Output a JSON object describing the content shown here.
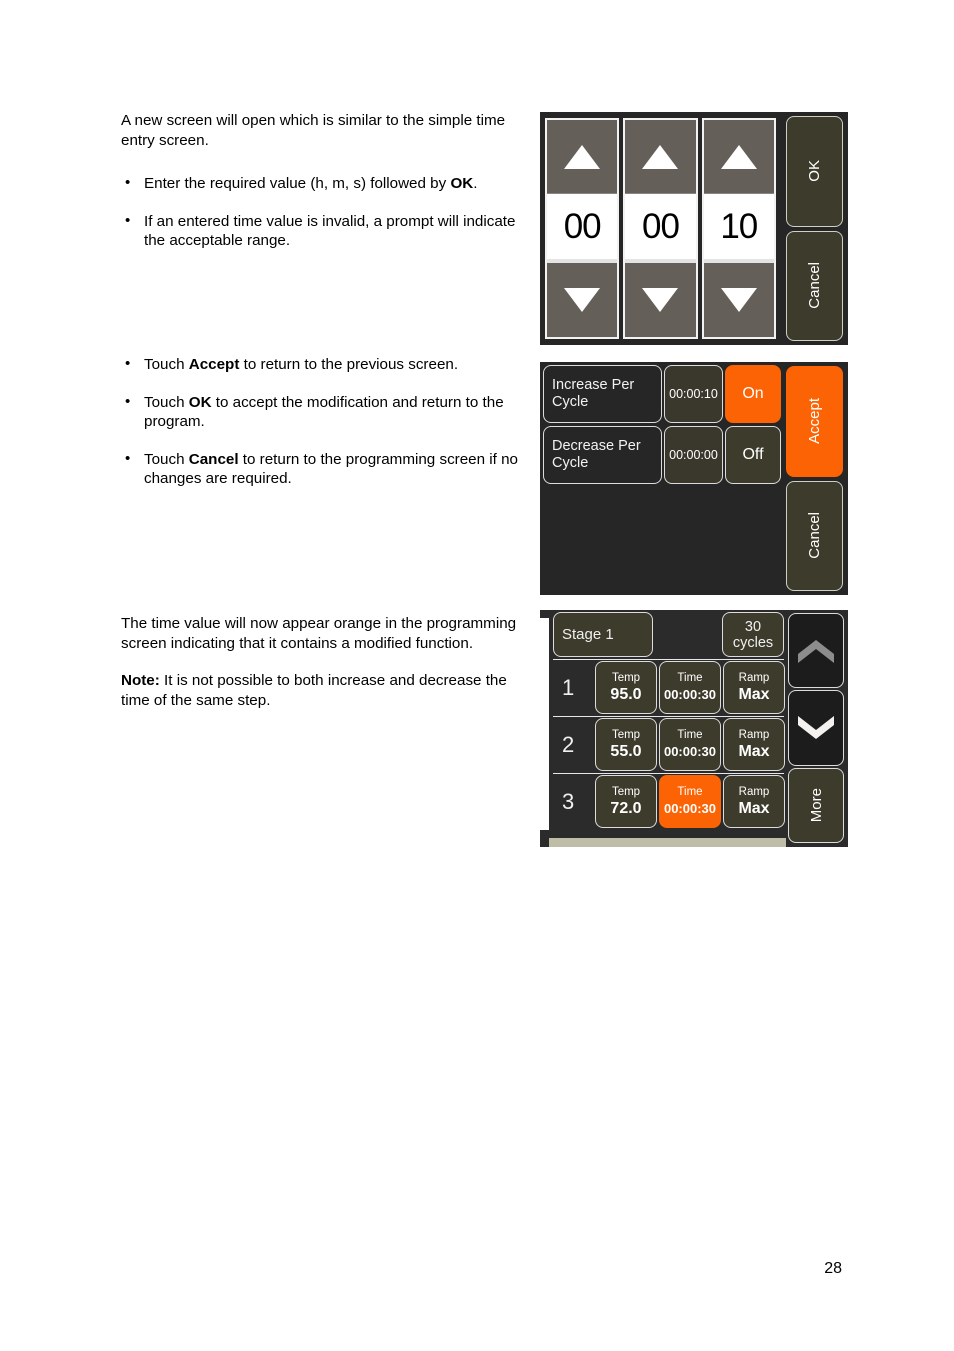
{
  "document": {
    "page_number": "28"
  },
  "body": {
    "block1": {
      "intro": "A new screen will open which is similar to the simple time entry screen.",
      "bullets": [
        {
          "pre": "Enter the required value (h, m, s) followed by ",
          "bold": "OK",
          "post": "."
        },
        {
          "pre": "If an entered time value is invalid, a prompt will indicate the acceptable range.",
          "bold": "",
          "post": ""
        }
      ]
    },
    "block2": {
      "bullets": [
        {
          "pre": "Touch ",
          "bold": "Accept",
          "post": " to return to the previous screen."
        },
        {
          "pre": "Touch ",
          "bold": "OK",
          "post": " to accept the modification and return to the program."
        },
        {
          "pre": "Touch ",
          "bold": "Cancel",
          "post": " to return to the programming screen if no changes are required."
        }
      ]
    },
    "block3": {
      "para": "The time value will now appear orange in the programming screen indicating that it contains a modified function.",
      "note_label": "Note:",
      "note_text": " It is not possible to both increase and decrease the time of the same step."
    }
  },
  "colors": {
    "accent_orange": "#fb6304",
    "button_olive": "#3d3b2c",
    "panel_dark": "#262626",
    "footer_tan": "#bfbda8"
  },
  "screen_time_entry": {
    "spinners": [
      {
        "up_icon": "triangle-up-icon",
        "value": "00",
        "down_icon": "triangle-down-icon"
      },
      {
        "up_icon": "triangle-up-icon",
        "value": "00",
        "down_icon": "triangle-down-icon"
      },
      {
        "up_icon": "triangle-up-icon",
        "value": "10",
        "down_icon": "triangle-down-icon"
      }
    ],
    "buttons": [
      {
        "label": "OK"
      },
      {
        "label": "Cancel"
      }
    ]
  },
  "screen_per_cycle": {
    "rows": [
      {
        "label": "Increase Per Cycle",
        "time": "00:00:10",
        "state": "On",
        "state_active": true
      },
      {
        "label": "Decrease Per Cycle",
        "time": "00:00:00",
        "state": "Off",
        "state_active": false
      }
    ],
    "buttons": [
      {
        "label": "Accept",
        "accent": true
      },
      {
        "label": "Cancel",
        "accent": false
      }
    ]
  },
  "screen_program": {
    "stage_label": "Stage 1",
    "cycles_number": "30",
    "cycles_unit": "cycles",
    "steps": [
      {
        "number": "1",
        "temp_caption": "Temp",
        "temp_value": "95.0",
        "time_caption": "Time",
        "time_value": "00:00:30",
        "time_highlight": false,
        "ramp_caption": "Ramp",
        "ramp_value": "Max"
      },
      {
        "number": "2",
        "temp_caption": "Temp",
        "temp_value": "55.0",
        "time_caption": "Time",
        "time_value": "00:00:30",
        "time_highlight": false,
        "ramp_caption": "Ramp",
        "ramp_value": "Max"
      },
      {
        "number": "3",
        "temp_caption": "Temp",
        "temp_value": "72.0",
        "time_caption": "Time",
        "time_value": "00:00:30",
        "time_highlight": true,
        "ramp_caption": "Ramp",
        "ramp_value": "Max"
      }
    ],
    "nav": {
      "up_icon": "chevron-up-icon",
      "down_icon": "chevron-down-icon",
      "more_label": "More"
    }
  }
}
